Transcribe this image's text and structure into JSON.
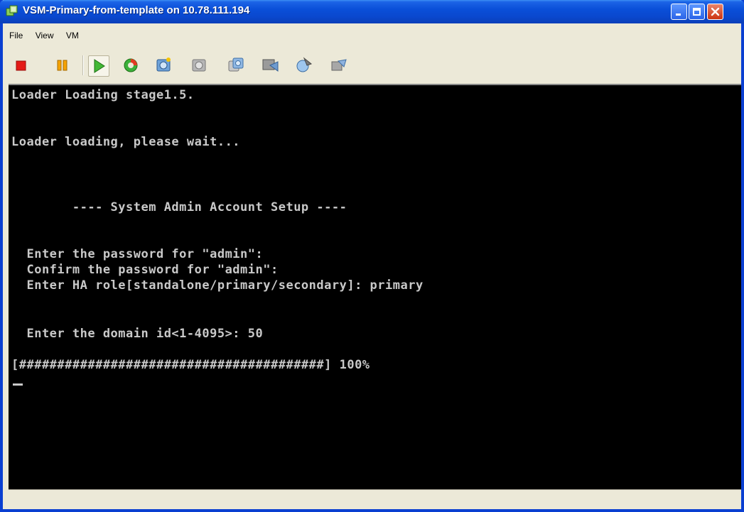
{
  "window": {
    "title": "VSM-Primary-from-template on 10.78.111.194",
    "titlebar_color": "#0a4fd8"
  },
  "menu": {
    "items": [
      "File",
      "View",
      "VM"
    ]
  },
  "toolbar": {
    "icons": [
      "power-off-icon",
      "suspend-icon",
      "power-on-icon",
      "reset-icon",
      "snapshot-icon",
      "revert-snapshot-icon",
      "snapshot-manager-icon",
      "connect-device-icon",
      "install-tools-icon",
      "settings-icon"
    ]
  },
  "console": {
    "lines": [
      "Loader Loading stage1.5.",
      "Loader loading, please wait...",
      "        ---- System Admin Account Setup ----",
      "  Enter the password for \"admin\":",
      "  Confirm the password for \"admin\":",
      "  Enter HA role[standalone/primary/secondary]: primary",
      "  Enter the domain id<1-4095>: 50",
      "[########################################] 100%"
    ],
    "text_color": "#c9c9c9",
    "background": "#000000"
  }
}
